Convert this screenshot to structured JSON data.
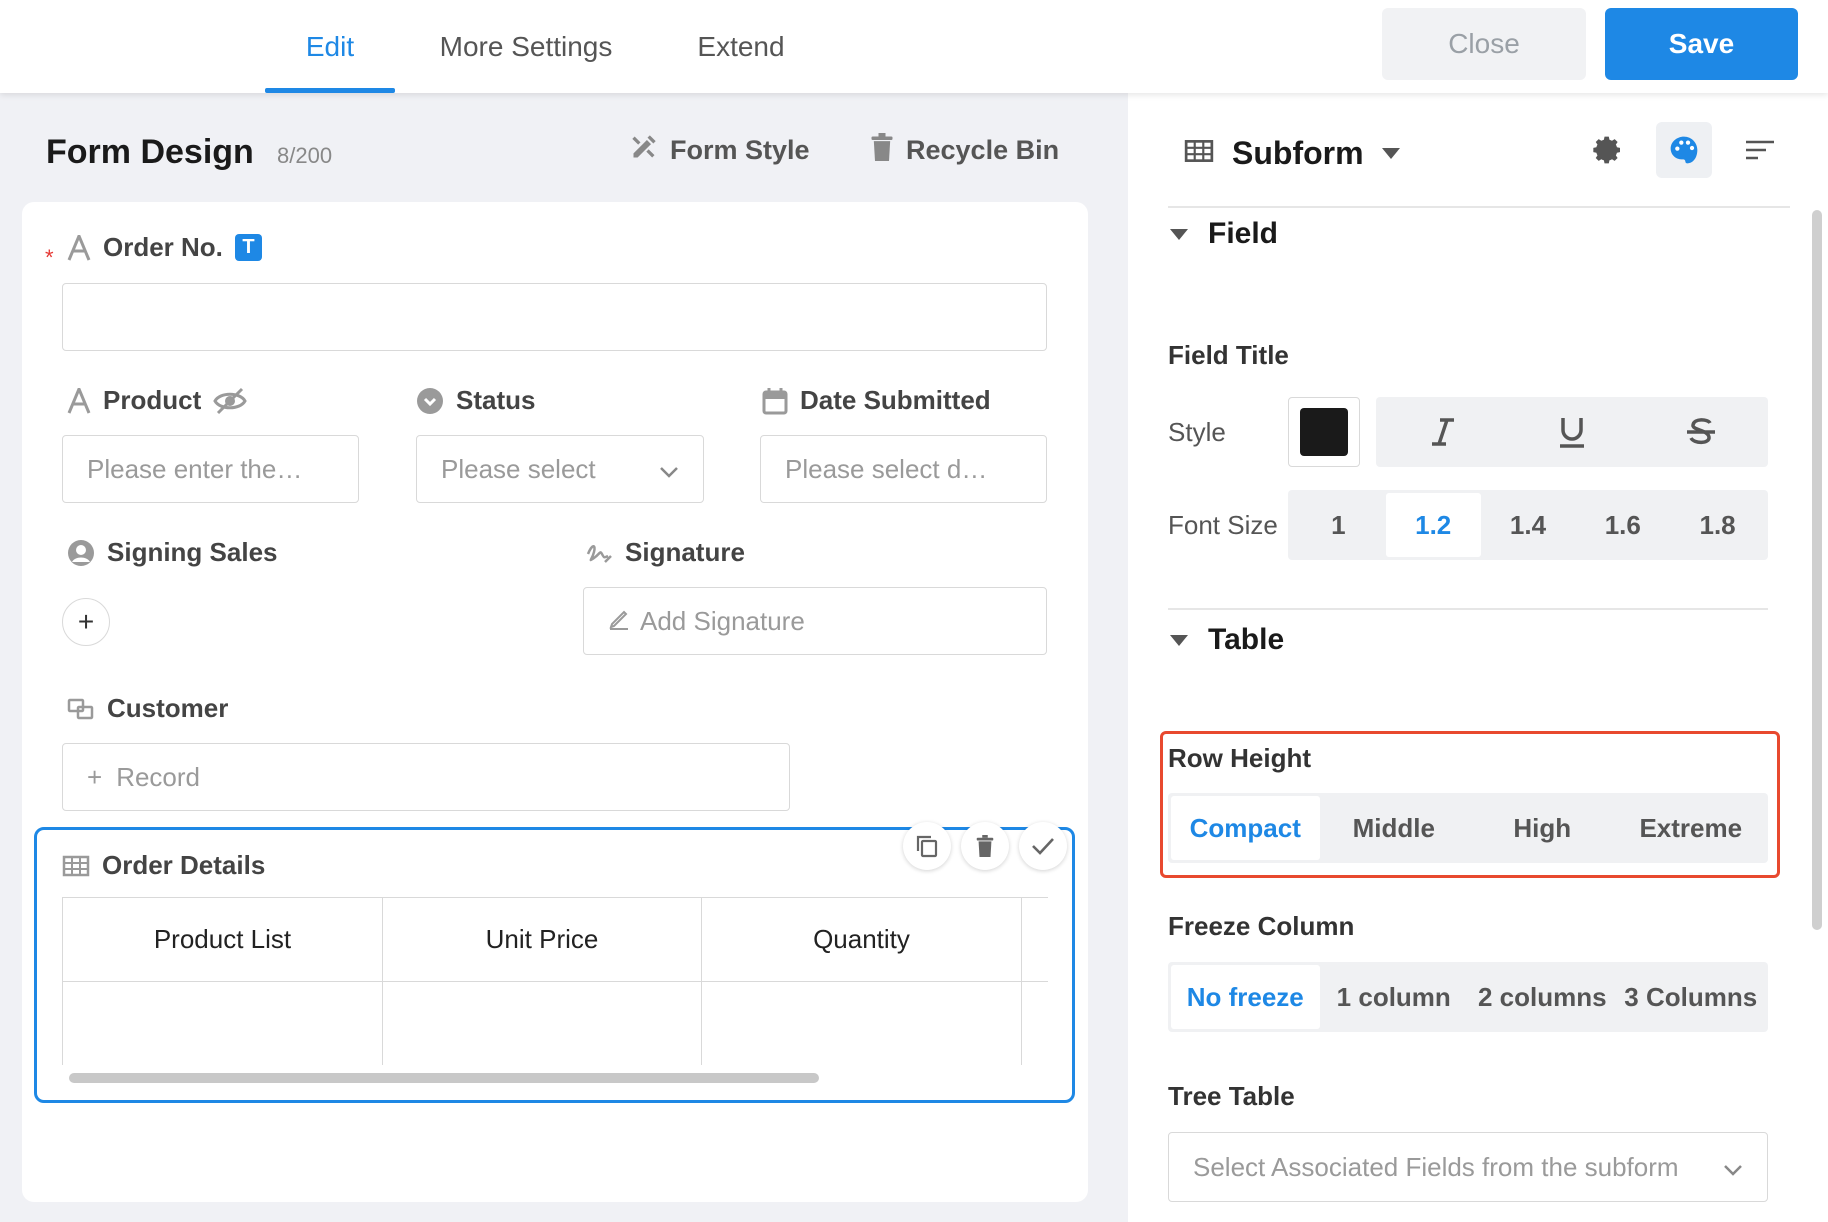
{
  "header": {
    "tabs": [
      {
        "label": "Edit",
        "active": true
      },
      {
        "label": "More Settings",
        "active": false
      },
      {
        "label": "Extend",
        "active": false
      }
    ],
    "close_label": "Close",
    "save_label": "Save"
  },
  "form": {
    "title": "Form Design",
    "count": "8/200",
    "form_style_label": "Form Style",
    "recycle_bin_label": "Recycle Bin",
    "fields": {
      "order_no": {
        "label": "Order No.",
        "badge": "T",
        "required": "*"
      },
      "product": {
        "label": "Product",
        "placeholder": "Please enter the…"
      },
      "status": {
        "label": "Status",
        "placeholder": "Please select"
      },
      "date_submitted": {
        "label": "Date Submitted",
        "placeholder": "Please select d…"
      },
      "signing_sales": {
        "label": "Signing Sales",
        "add_symbol": "+"
      },
      "signature": {
        "label": "Signature",
        "button": "Add Signature"
      },
      "customer": {
        "label": "Customer",
        "button": "Record"
      }
    },
    "subform": {
      "label": "Order Details",
      "columns": [
        "Product List",
        "Unit Price",
        "Quantity"
      ]
    }
  },
  "panel": {
    "component_name": "Subform",
    "field_section": "Field",
    "field_title": "Field Title",
    "style_label": "Style",
    "style_color": "#1a1a1a",
    "font_size_label": "Font Size",
    "font_sizes": [
      "1",
      "1.2",
      "1.4",
      "1.6",
      "1.8"
    ],
    "font_size_selected": "1.2",
    "table_section": "Table",
    "row_height_label": "Row Height",
    "row_heights": [
      "Compact",
      "Middle",
      "High",
      "Extreme"
    ],
    "row_height_selected": "Compact",
    "freeze_label": "Freeze Column",
    "freeze_options": [
      "No freeze",
      "1 column",
      "2 columns",
      "3 Columns"
    ],
    "freeze_selected": "No freeze",
    "tree_table_label": "Tree Table",
    "tree_table_placeholder": "Select Associated Fields from the subform",
    "highlight_color": "#e8492f",
    "accent_color": "#1e88e5"
  }
}
